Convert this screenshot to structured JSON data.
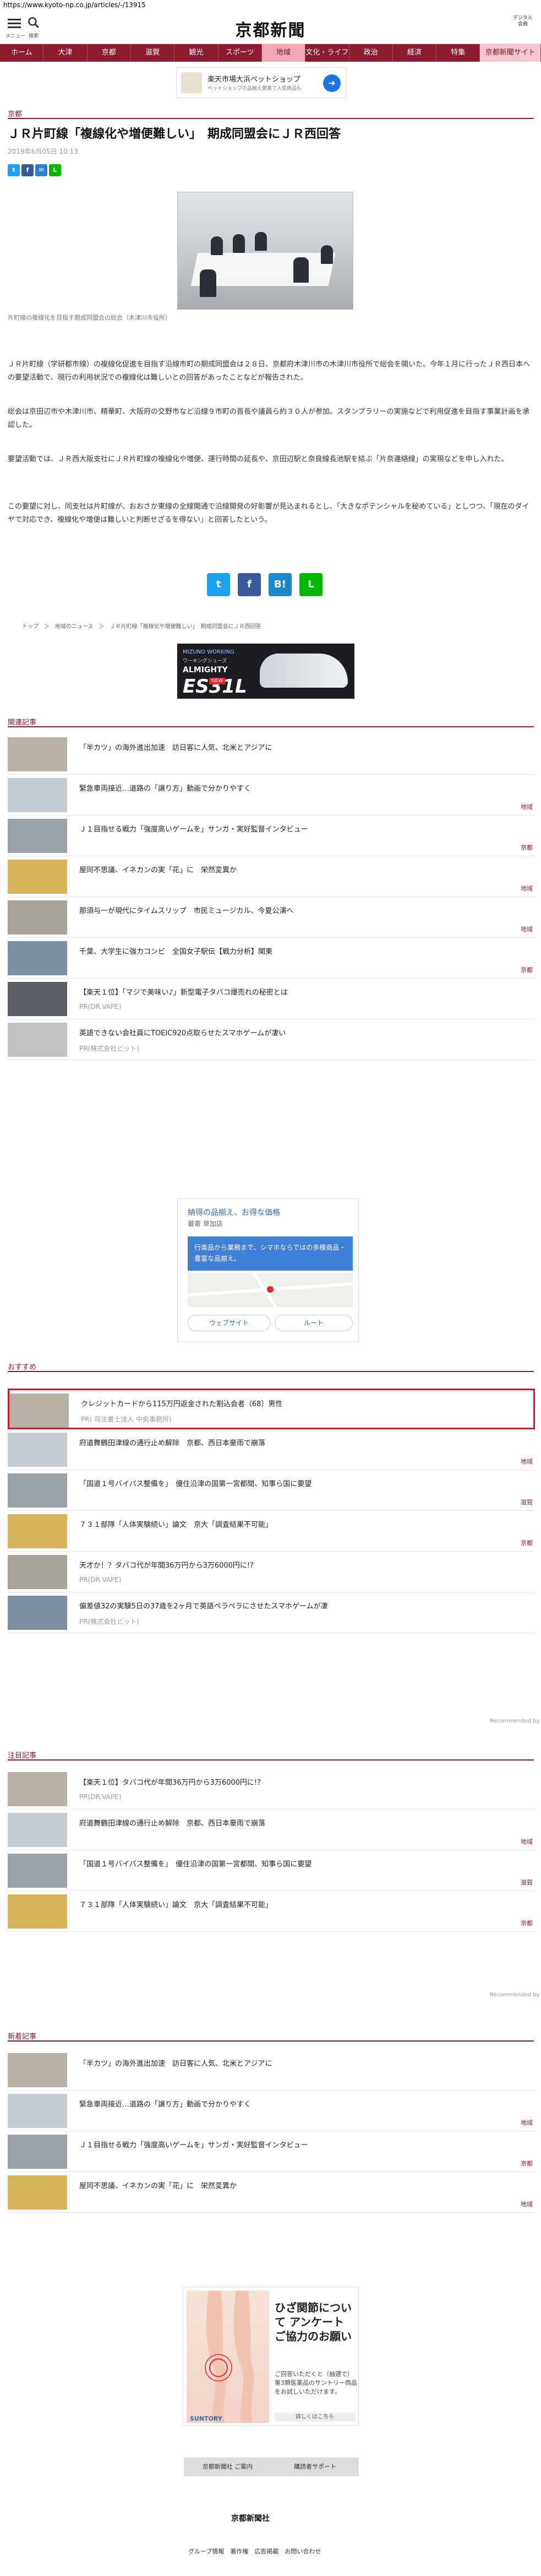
{
  "url": "https://www.kyoto-np.co.jp/articles/-/13915",
  "header": {
    "menu_label": "メニュー",
    "search_label": "検索",
    "logo": "京都新聞",
    "digital_label": "デジタル会員"
  },
  "nav": {
    "items": [
      "ホーム",
      "大津",
      "京都",
      "滋賀",
      "観光",
      "スポーツ",
      "地域",
      "文化・ライフ",
      "政治",
      "経済",
      "特集",
      "京都新聞サイト"
    ],
    "active_index": 6
  },
  "top_ad": {
    "title": "楽天市場大浜ペットショップ",
    "subtitle": "ペットショップの品揃え豊富で人気商品も"
  },
  "article": {
    "section": "京都",
    "title": "ＪＲ片町線「複線化や増便難しい」　期成同盟会にＪＲ西回答",
    "date": "2019年6月05日 10:13",
    "caption": "片町線の複線化を目指す期成同盟会の総会（木津川市役所）",
    "paragraphs": [
      "ＪＲ片町線（学研都市線）の複線化促進を目指す沿線市町の期成同盟会は２８日、京都府木津川市の木津川市役所で総会を開いた。今年１月に行ったＪＲ西日本への要望活動で、現行の利用状況での複線化は難しいとの回答があったことなどが報告された。",
      "総会は京田辺市や木津川市、精華町、大阪府の交野市など沿線９市町の首長や議員ら約３０人が参加。スタンプラリーの実施などで利用促進を目指す事業計画を承認した。",
      "要望活動では、ＪＲ西大阪支社にＪＲ片町線の複線化や増便、運行時間の延長や、京田辺駅と奈良線長池駅を結ぶ「片奈連絡線」の実現などを申し入れた。",
      "この要望に対し、同支社は片町線が、おおさか東線の全線開通で沿線開発の好影響が見込まれるとし、「大きなポテンシャルを秘めている」としつつ、「現在のダイヤで対応でき、複線化や増便は難しいと判断せざるを得ない」と回答したという。"
    ]
  },
  "share": [
    "Twitter",
    "Facebook",
    "はてなブックマーク",
    "LINE"
  ],
  "breadcrumb": "トップ　＞　地域のニュース　＞　ＪＲ片町線「複線化や増便難しい」　期成同盟会にＪＲ西回答",
  "shoe_ad": {
    "brand": "MIZUNO WORKING",
    "sub": "ワーキングシューズ",
    "model": "ALMIGHTY",
    "name": "ES31L",
    "badge": "NEW"
  },
  "related": {
    "heading": "関連記事",
    "items": [
      {
        "title": "「半カツ」の海外進出加速　訪日客に人気、北米とアジアに",
        "sub": "",
        "cat": ""
      },
      {
        "title": "緊急車両接近…道路の「譲り方」動画で分かりやすく",
        "sub": "",
        "cat": "地域"
      },
      {
        "title": "Ｊ１目指せる戦力「強度高いゲームを」サンガ・実好監督インタビュー",
        "sub": "",
        "cat": "京都"
      },
      {
        "title": "屋同不思議、イネカンの実「花」に　栄然変異か",
        "sub": "",
        "cat": "地域"
      },
      {
        "title": "那須与一が現代にタイムスリップ　市民ミュージカル、今夏公演へ",
        "sub": "",
        "cat": "地域"
      },
      {
        "title": "千葉、大学生に強力コンビ　全国女子駅伝【戦力分析】関東",
        "sub": "",
        "cat": "京都"
      },
      {
        "title": "【楽天１位】「マジで美味い♪」新型電子タバコ爆売れの秘密とは",
        "sub": "PR(DR.VAPE)",
        "cat": ""
      },
      {
        "title": "英語できない会社員にTOEIC920点取らせたスマホゲームが凄い",
        "sub": "PR(株式会社ビット)",
        "cat": ""
      }
    ]
  },
  "map_ad": {
    "title": "納得の品揃え、お得な価格",
    "subtitle": "最寄 草加店",
    "box_text": "行楽品から業務まで、シマホならではの多様商品・豊富な品揃え。",
    "btn_web": "ウェブサイト",
    "btn_route": "ルート"
  },
  "recommend": {
    "heading": "おすすめ",
    "items": [
      {
        "title": "クレジットカードから115万円返金された割込会者（68）男性",
        "sub": "PR( 司法書士法人 中央事務所)",
        "cat": ""
      },
      {
        "title": "府道舞鶴田津線の通行止め解除　京都、西日本豪雨で崩落",
        "sub": "",
        "cat": "地域"
      },
      {
        "title": "「国道１号バイパス整備を」　優住沿津の国第一宮都間、知事ら国に要望",
        "sub": "",
        "cat": "滋賀"
      },
      {
        "title": "７３１部隊「人体実験続い」論文　京大「調査結果不可能」",
        "sub": "",
        "cat": "京都"
      },
      {
        "title": "天才か！？タバコ代が年間36万円から3万6000円に!?",
        "sub": "PR(DR.VAPE)",
        "cat": ""
      },
      {
        "title": "偏差値32の実験5日の37歳を2ヶ月で英語ペラペラにさせたスマホゲームが凄",
        "sub": "PR(株式会社ビット)",
        "cat": ""
      }
    ],
    "powered": "Recommended by"
  },
  "featured": {
    "heading": "注目記事",
    "items": [
      {
        "title": "【楽天１位】タバコ代が年間36万円から3万6000円に!?",
        "sub": "PR(DR.VAPE)",
        "cat": ""
      },
      {
        "title": "府道舞鶴田津線の通行止め解除　京都、西日本豪雨で崩落",
        "sub": "",
        "cat": "地域"
      },
      {
        "title": "「国道１号バイパス整備を」　優住沿津の国第一宮都間、知事ら国に要望",
        "sub": "",
        "cat": "滋賀"
      },
      {
        "title": "７３１部隊「人体実験続い」論文　京大「調査結果不可能」",
        "sub": "",
        "cat": "京都"
      }
    ],
    "powered": "Recommended by"
  },
  "newest": {
    "heading": "新着記事",
    "items": [
      {
        "title": "「半カツ」の海外進出加速　訪日客に人気、北米とアジアに",
        "sub": "",
        "cat": ""
      },
      {
        "title": "緊急車両接近…道路の「譲り方」動画で分かりやすく",
        "sub": "",
        "cat": "地域"
      },
      {
        "title": "Ｊ１目指せる戦力「強度高いゲームを」サンガ・実好監督インタビュー",
        "sub": "",
        "cat": "京都"
      },
      {
        "title": "屋同不思議、イネカンの実「花」に　栄然変異か",
        "sub": "",
        "cat": "地域"
      }
    ]
  },
  "leg_ad": {
    "headline": "ひざ関節について アンケート ご協力のお願い",
    "small": "ご回答いただくと（抽選で）第3類医薬品のサントリー商品をお試しいただけます。",
    "brand": "SUNTORY",
    "more": "詳しくはこちら"
  },
  "footer": {
    "buttons": [
      "京都新聞社 ご案内",
      "購読者サポート"
    ],
    "logo": "京都新聞社",
    "links": "グループ情報　著作権　広告掲載　お問い合わせ"
  },
  "colors": {
    "brand": "#8c1b2f",
    "highlight": "#d2182c"
  }
}
